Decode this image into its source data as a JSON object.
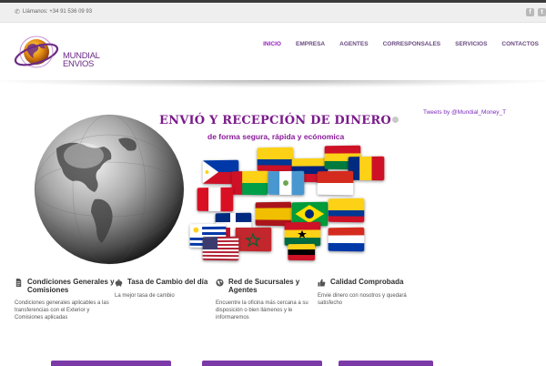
{
  "topbar": {
    "phone_label": "Llámanos: +34 91 536 09 93",
    "social_icons": [
      "facebook-icon",
      "twitter-icon"
    ]
  },
  "logo": {
    "line1": "MUNDIAL",
    "line2": "ENVIOS"
  },
  "nav": {
    "items": [
      "INICIO",
      "EMPRESA",
      "AGENTES",
      "CORRESPONSALES",
      "SERVICIOS",
      "CONTACTOS"
    ],
    "active": "INICIO"
  },
  "hero": {
    "title": "ENVIÓ Y RECEPCIÓN DE DINERO",
    "subtitle": "de forma segura, rápida y ecónomica"
  },
  "sidebar": {
    "tweets_link": "Tweets by @Mundial_Money_T"
  },
  "features": [
    {
      "icon": "document-icon",
      "title": "Condiciones Generales y Comisiones",
      "text": "Condiciones generales aplicables a las transferencias con el Exterior y Comisiones aplicadas"
    },
    {
      "icon": "piggy-bank-icon",
      "title": "Tasa de Cambio del día",
      "text": "La mejor tasa de cambio"
    },
    {
      "icon": "globe-icon",
      "title": "Red de Sucursales y Agentes",
      "text": "Encuentre la oficina más cercana a su disposición o bien llámenos y le informaremos"
    },
    {
      "icon": "thumbs-up-icon",
      "title": "Calidad Comprobada",
      "text": "Envie dinero con nosotros y quedará satisfecho"
    }
  ],
  "colors": {
    "accent": "#9a1dc2",
    "brand_purple": "#6b2a86",
    "nav_text": "#6a4a80"
  }
}
